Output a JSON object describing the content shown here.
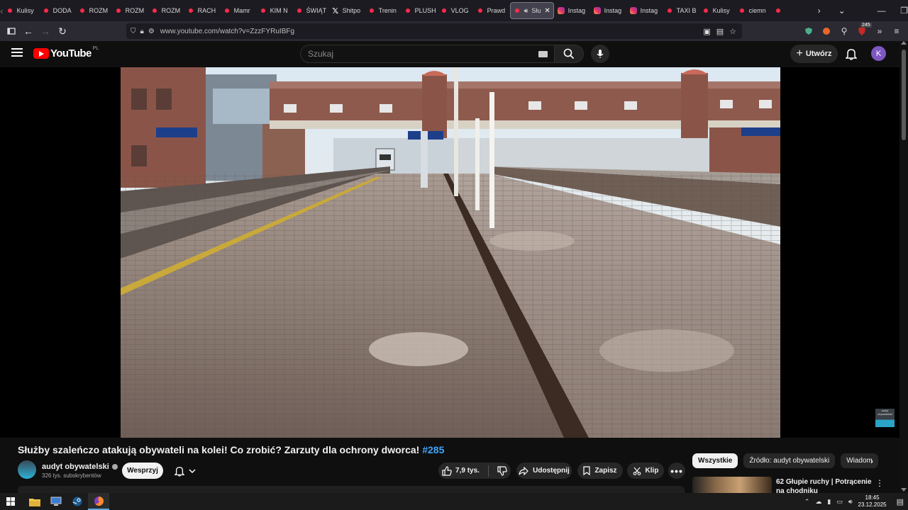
{
  "browser": {
    "tabs": [
      {
        "label": "Kulisy",
        "icon": "youtube-icon",
        "active": false
      },
      {
        "label": "DODA",
        "icon": "youtube-icon",
        "active": false
      },
      {
        "label": "ROZM",
        "icon": "youtube-icon",
        "active": false
      },
      {
        "label": "ROZM",
        "icon": "youtube-icon",
        "active": false
      },
      {
        "label": "ROZM",
        "icon": "youtube-icon",
        "active": false
      },
      {
        "label": "RACH",
        "icon": "youtube-icon",
        "active": false
      },
      {
        "label": "Mamr",
        "icon": "youtube-icon",
        "active": false
      },
      {
        "label": "KIM N",
        "icon": "youtube-icon",
        "active": false
      },
      {
        "label": "ŚWIĄT",
        "icon": "youtube-icon",
        "active": false
      },
      {
        "label": "Shitpo",
        "icon": "x-icon",
        "active": false
      },
      {
        "label": "Trenin",
        "icon": "youtube-icon",
        "active": false
      },
      {
        "label": "PLUSH",
        "icon": "youtube-icon",
        "active": false
      },
      {
        "label": "VLOG",
        "icon": "youtube-icon",
        "active": false
      },
      {
        "label": "Prawd",
        "icon": "youtube-icon",
        "active": false
      },
      {
        "label": "Słu",
        "icon": "youtube-icon",
        "active": true
      },
      {
        "label": "Instag",
        "icon": "instagram-icon",
        "active": false
      },
      {
        "label": "Instag",
        "icon": "instagram-icon",
        "active": false
      },
      {
        "label": "Instag",
        "icon": "instagram-icon",
        "active": false
      },
      {
        "label": "TAXI B",
        "icon": "youtube-icon",
        "active": false
      },
      {
        "label": "Kulisy",
        "icon": "youtube-icon",
        "active": false
      },
      {
        "label": "ciemn",
        "icon": "youtube-icon",
        "active": false
      },
      {
        "label": "",
        "icon": "youtube-icon",
        "active": false
      }
    ],
    "url": "www.youtube.com/watch?v=ZzzFYRuIBFg",
    "extensions_badge": "245"
  },
  "youtube": {
    "logo_text": "YouTube",
    "logo_region": "PL",
    "search_placeholder": "Szukaj",
    "create_label": "Utwórz",
    "avatar_letter": "K"
  },
  "video": {
    "title": "Służby szaleńczo atakują obywateli na kolei! Co zrobić? Zarzuty dla ochrony dworca!",
    "hashtag": "#285",
    "watermark_text": "audyt obywatelski"
  },
  "channel": {
    "name": "audyt obywatelski",
    "subscribers": "326 tys. subskrybentów",
    "support_label": "Wesprzyj"
  },
  "actions": {
    "likes": "7,9 tys.",
    "share_label": "Udostępnij",
    "save_label": "Zapisz",
    "clip_label": "Klip"
  },
  "chips": [
    "Wszystkie",
    "Źródło: audyt obywatelski",
    "Wiadom"
  ],
  "recommendation": {
    "title": "62 Głupie ruchy | Potrącenie na chodniku"
  },
  "taskbar": {
    "time": "18:45",
    "date": "23.12.2025"
  },
  "colors": {
    "youtube_red": "#ff0000",
    "accent_blue": "#3ea6ff",
    "avatar_purple": "#7e57c2"
  }
}
